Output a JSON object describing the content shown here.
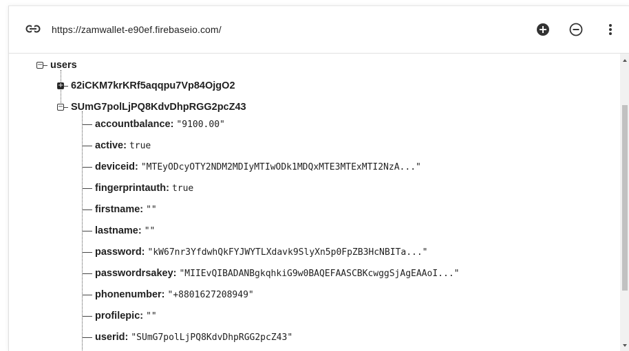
{
  "toolbar": {
    "url": "https://zamwallet-e90ef.firebaseio.com/",
    "link_icon": "link-icon",
    "add_icon": "add-circle-icon",
    "remove_icon": "remove-circle-icon",
    "menu_icon": "more-vert-icon"
  },
  "tree": {
    "root": {
      "key": "users",
      "toggle": "−"
    },
    "children": [
      {
        "key": "62iCKM7krKRf5aqqpu7Vp84OjgO2",
        "toggle": "+",
        "expanded": false
      },
      {
        "key": "SUmG7polLjPQ8KdvDhpRGG2pcZ43",
        "toggle": "−",
        "expanded": true
      }
    ],
    "fields": [
      {
        "key": "accountbalance:",
        "value": "\"9100.00\""
      },
      {
        "key": "active:",
        "value": "true"
      },
      {
        "key": "deviceid:",
        "value": "\"MTEyODcyOTY2NDM2MDIyMTIwODk1MDQxMTE3MTExMTI2NzA...\""
      },
      {
        "key": "fingerprintauth:",
        "value": "true"
      },
      {
        "key": "firstname:",
        "value": "\"\""
      },
      {
        "key": "lastname:",
        "value": "\"\""
      },
      {
        "key": "password:",
        "value": "\"kW67nr3YfdwhQkFYJWYTLXdavk9SlyXn5p0FpZB3HcNBITa...\""
      },
      {
        "key": "passwordrsakey:",
        "value": "\"MIIEvQIBADANBgkqhkiG9w0BAQEFAASCBKcwggSjAgEAAoI...\""
      },
      {
        "key": "phonenumber:",
        "value": "\"+8801627208949\""
      },
      {
        "key": "profilepic:",
        "value": "\"\""
      },
      {
        "key": "userid:",
        "value": "\"SUmG7polLjPQ8KdvDhpRGG2pcZ43\""
      }
    ]
  }
}
